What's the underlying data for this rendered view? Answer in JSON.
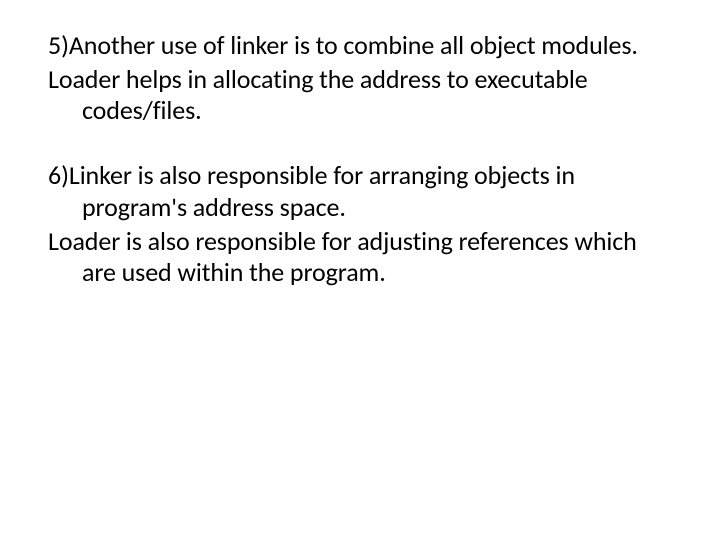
{
  "slide": {
    "p1": "5)Another use of linker is to combine all object modules.",
    "p2": "Loader helps in allocating the address to executable codes/files.",
    "p3": "6)Linker is also responsible for arranging objects in program's address space.",
    "p4": "Loader is also responsible for adjusting references which are used within the program."
  }
}
